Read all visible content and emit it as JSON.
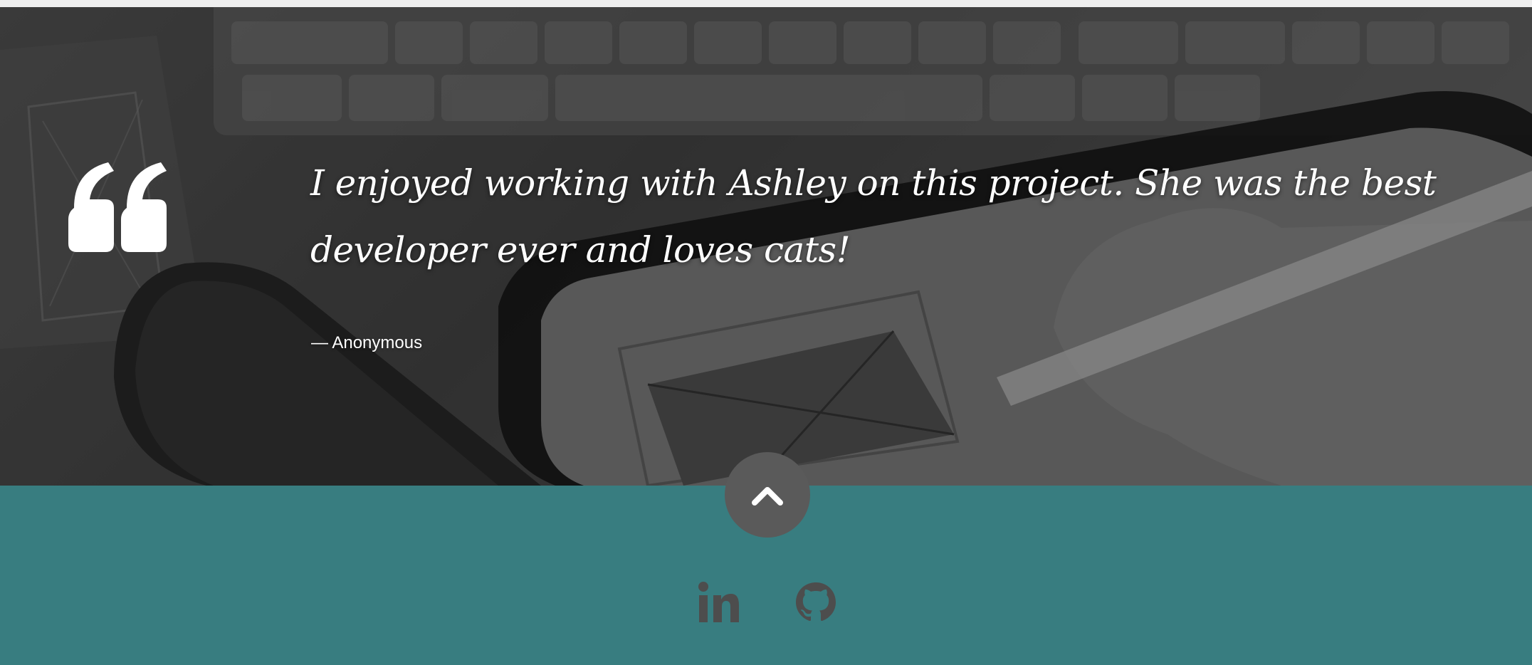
{
  "testimonial": {
    "quote": "I enjoyed working with Ashley on this project. She was the best developer ever and loves cats!",
    "author": "— Anonymous"
  },
  "icons": {
    "quote": "quote-icon",
    "back_to_top": "chevron-up-icon",
    "linkedin": "linkedin-icon",
    "github": "github-icon"
  },
  "colors": {
    "footer_background": "#387d80",
    "back_to_top_background": "#5a5a5a",
    "social_icon": "#4d4d4d",
    "quote_text": "#ffffff"
  }
}
